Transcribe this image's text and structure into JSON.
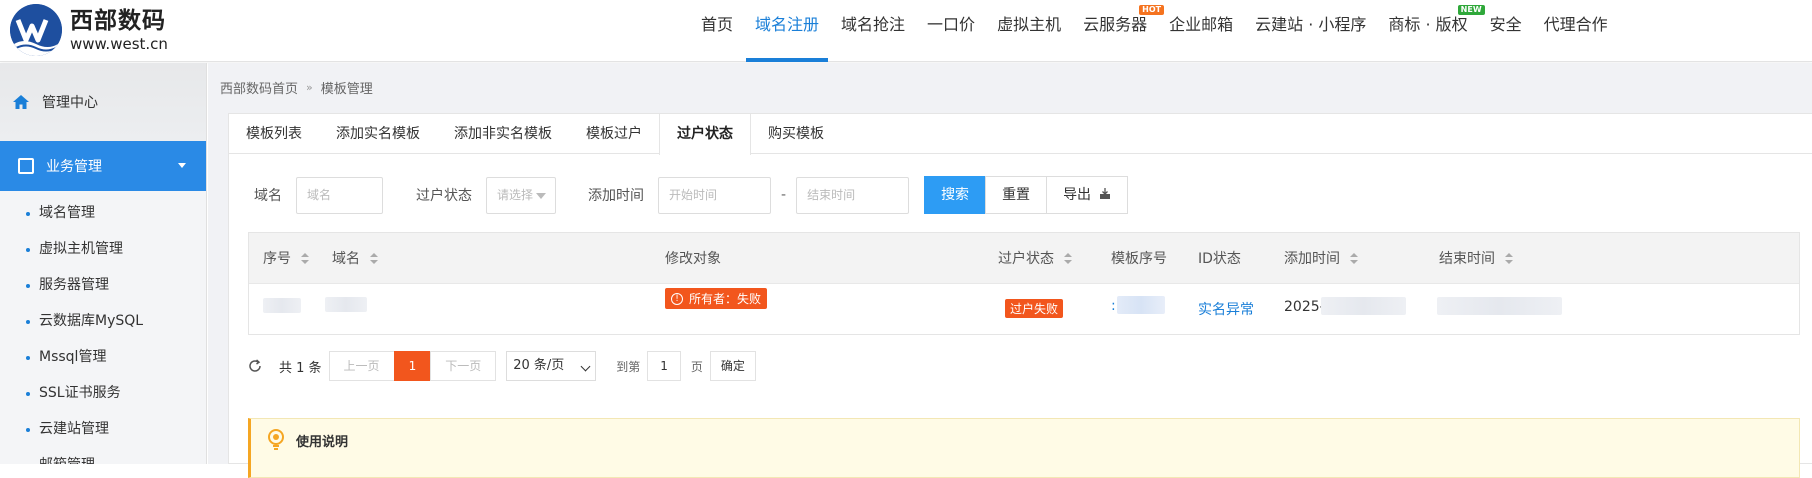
{
  "brand": {
    "name": "西部数码",
    "url": "www.west.cn"
  },
  "nav": [
    {
      "label": "首页"
    },
    {
      "label": "域名注册",
      "active": true
    },
    {
      "label": "域名抢注"
    },
    {
      "label": "一口价"
    },
    {
      "label": "虚拟主机"
    },
    {
      "label": "云服务器",
      "badge": "HOT"
    },
    {
      "label": "企业邮箱"
    },
    {
      "label": "云建站 · 小程序"
    },
    {
      "label": "商标 · 版权",
      "badge": "NEW"
    },
    {
      "label": "安全"
    },
    {
      "label": "代理合作"
    }
  ],
  "sidebar": {
    "home": "管理中心",
    "group": "业务管理",
    "items": [
      "域名管理",
      "虚拟主机管理",
      "服务器管理",
      "云数据库MySQL",
      "Mssql管理",
      "SSL证书服务",
      "云建站管理",
      "邮箱管理"
    ]
  },
  "breadcrumb": {
    "home": "西部数码首页",
    "sep": "»",
    "current": "模板管理"
  },
  "tabs": [
    {
      "label": "模板列表"
    },
    {
      "label": "添加实名模板"
    },
    {
      "label": "添加非实名模板"
    },
    {
      "label": "模板过户"
    },
    {
      "label": "过户状态",
      "active": true
    },
    {
      "label": "购买模板"
    }
  ],
  "filters": {
    "domain_label": "域名",
    "domain_placeholder": "域名",
    "status_label": "过户状态",
    "status_placeholder": "请选择",
    "time_label": "添加时间",
    "start_placeholder": "开始时间",
    "dash": "-",
    "end_placeholder": "结束时间",
    "search": "搜索",
    "reset": "重置",
    "export": "导出"
  },
  "table": {
    "headers": {
      "index": "序号",
      "domain": "域名",
      "target": "修改对象",
      "status": "过户状态",
      "template_no": "模板序号",
      "id_status": "ID状态",
      "added": "添加时间",
      "ended": "结束时间"
    },
    "rows": [
      {
        "target": "所有者：失败",
        "status": "过户失败",
        "template_no_prefix": ":",
        "id_status": "实名异常",
        "added_prefix": "2025-"
      }
    ]
  },
  "pagination": {
    "total": "共 1 条",
    "prev": "上一页",
    "current": "1",
    "next": "下一页",
    "page_size": "20 条/页",
    "goto": "到第",
    "goto_value": "1",
    "page_unit": "页",
    "confirm": "确定"
  },
  "notice": {
    "title": "使用说明"
  },
  "colors": {
    "accent": "#1a7fd8",
    "primary_button": "#2d9cf4",
    "error": "#f2561d",
    "hot": "#f5731f",
    "new": "#2fa83a"
  }
}
